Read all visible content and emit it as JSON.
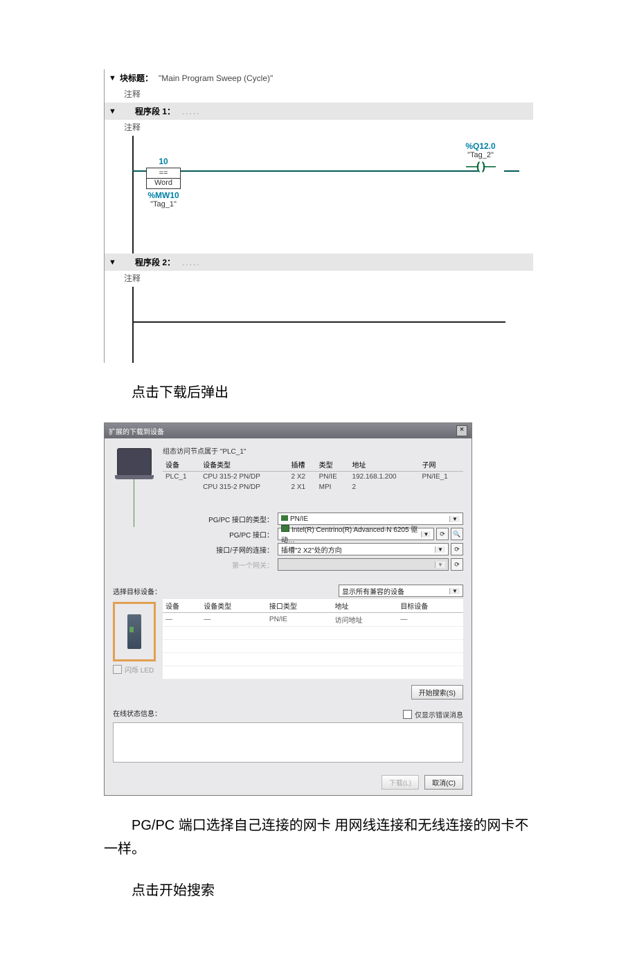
{
  "editor": {
    "block_title_label": "块标题：",
    "block_title_value": "\"Main Program Sweep (Cycle)\"",
    "comment_label": "注释",
    "network1": {
      "title": "程序段 1：",
      "dots": ".....",
      "comment": "注释",
      "compare_value": "10",
      "compare_eq": "==",
      "compare_type": "Word",
      "addr": "%MW10",
      "tag": "\"Tag_1\"",
      "coil_addr": "%Q12.0",
      "coil_tag": "\"Tag_2\"",
      "coil_sym": "—(  )—"
    },
    "network2": {
      "title": "程序段 2：",
      "dots": ".....",
      "comment": "注释"
    }
  },
  "para1": "点击下载后弹出",
  "dialog": {
    "title": "扩展的下载到设备",
    "close": "×",
    "cfg_label": "组态访问节点属于 \"PLC_1\"",
    "columns": {
      "device": "设备",
      "devtype": "设备类型",
      "slot": "插槽",
      "type": "类型",
      "addr": "地址",
      "subnet": "子网"
    },
    "rows": [
      {
        "device": "PLC_1",
        "devtype": "CPU 315-2 PN/DP",
        "slot": "2 X2",
        "type": "PN/IE",
        "addr": "192.168.1.200",
        "subnet": "PN/IE_1"
      },
      {
        "device": "",
        "devtype": "CPU 315-2 PN/DP",
        "slot": "2 X1",
        "type": "MPI",
        "addr": "2",
        "subnet": ""
      }
    ],
    "fields": {
      "pgpc_type_label": "PG/PC 接口的类型：",
      "pgpc_type_value": "PN/IE",
      "pgpc_if_label": "PG/PC 接口：",
      "pgpc_if_value": "Intel(R) Centrino(R) Advanced-N 6205 驱动…",
      "conn_label": "接口/子网的连接：",
      "conn_value": "插槽\"2 X2\"处的方向",
      "gw_label": "第一个网关：",
      "gw_value": ""
    },
    "select_target_label": "选择目标设备：",
    "filter_value": "显示所有兼容的设备",
    "target_columns": {
      "device": "设备",
      "devtype": "设备类型",
      "iftype": "接口类型",
      "addr": "地址",
      "tdev": "目标设备"
    },
    "target_row": {
      "device": "—",
      "devtype": "—",
      "iftype": "PN/IE",
      "addr": "访问地址",
      "tdev": "—"
    },
    "flash_led": "闪烁 LED",
    "start_search": "开始搜索(S)",
    "status_label": "在线状态信息：",
    "only_error": "仅显示错误消息",
    "btn_download": "下载(L)",
    "btn_cancel": "取消(C)"
  },
  "para2": "PG/PC 端口选择自己连接的网卡 用网线连接和无线连接的网卡不一样。",
  "para3": "点击开始搜索"
}
